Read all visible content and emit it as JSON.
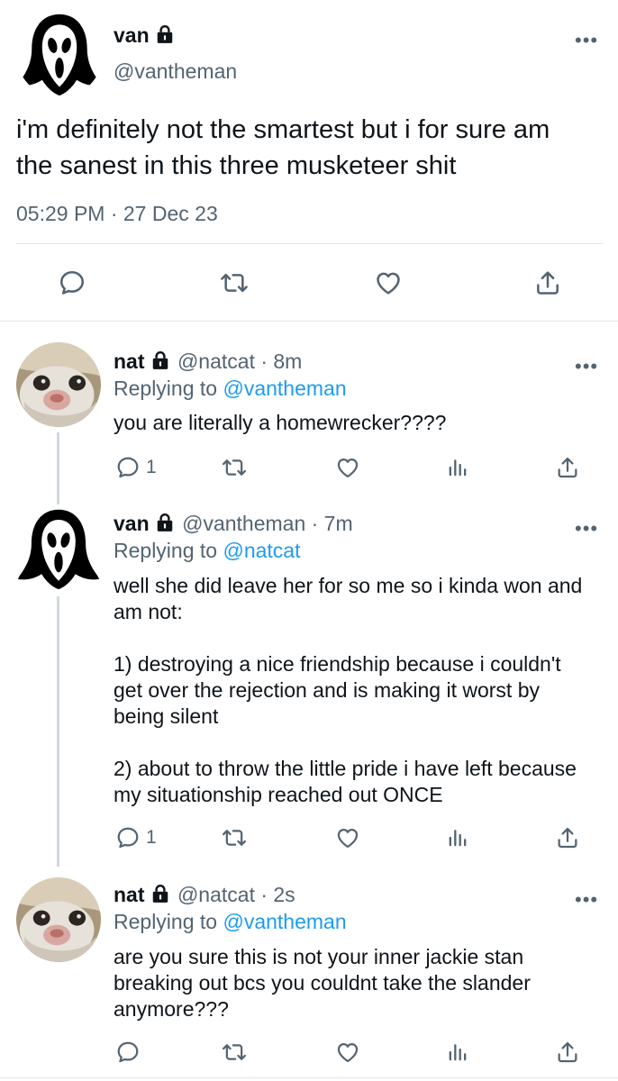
{
  "main_tweet": {
    "name": "van",
    "handle": "@vantheman",
    "text": "i'm definitely not the smartest but i for sure am the sanest in this three musketeer shit",
    "timestamp": "05:29 PM · 27 Dec 23",
    "more": "•••"
  },
  "replies": [
    {
      "name": "nat",
      "meta": "@natcat · 8m",
      "replying_prefix": "Replying to ",
      "replying_handle": "@vantheman",
      "text": "you are literally a homewrecker????",
      "reply_count": "1",
      "more": "•••"
    },
    {
      "name": "van",
      "meta": "@vantheman · 7m",
      "replying_prefix": "Replying to ",
      "replying_handle": "@natcat",
      "text": "well she did leave her for so me so i kinda won and am not:\n\n1) destroying a nice friendship because i couldn't get over the rejection and is making it worst by being silent\n\n2) about to throw the little pride i have left because my situationship reached out ONCE",
      "reply_count": "1",
      "more": "•••"
    },
    {
      "name": "nat",
      "meta": "@natcat · 2s",
      "replying_prefix": "Replying to ",
      "replying_handle": "@vantheman",
      "text": "are you sure this is not your inner jackie stan breaking out bcs you couldnt take the slander anymore???",
      "reply_count": "",
      "more": "•••"
    }
  ],
  "icons": {
    "reply": "reply-icon",
    "retweet": "retweet-icon",
    "like": "heart-icon",
    "views": "analytics-icon",
    "share": "share-icon",
    "lock": "lock-icon"
  },
  "colors": {
    "text": "#0f1419",
    "secondary": "#536471",
    "link": "#1d9bf0",
    "divider": "#e3e7ea",
    "thread_line": "#cfd9de"
  }
}
